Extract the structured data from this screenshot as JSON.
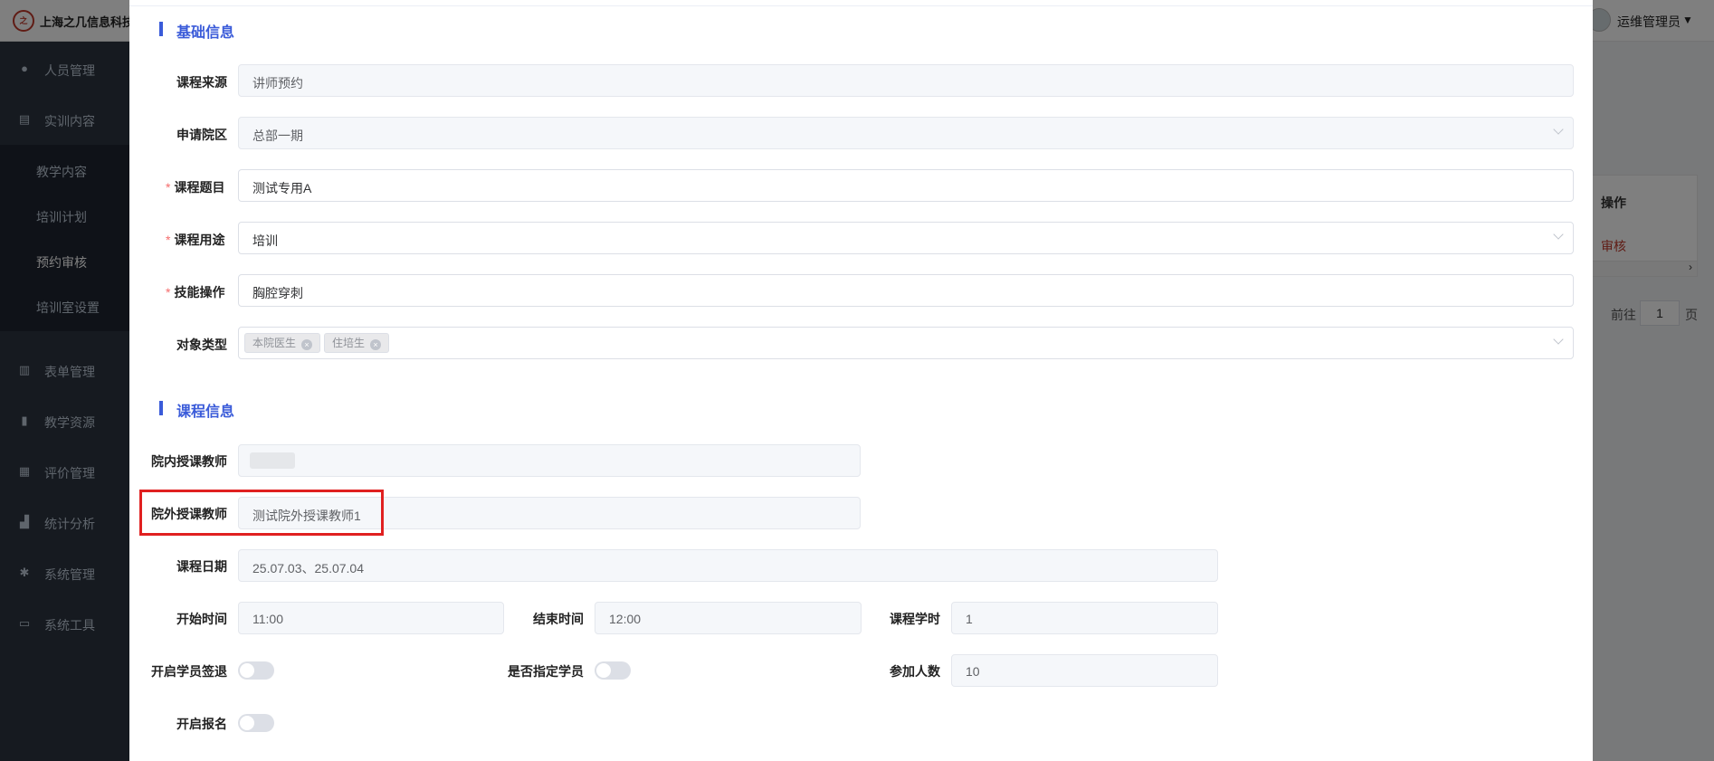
{
  "app": {
    "logo_text": "之",
    "title": "上海之几信息科技有限公司",
    "user_name": "运维管理员",
    "user_caret": "▼"
  },
  "sidebar": {
    "items": [
      {
        "label": "人员管理",
        "icon": "user-icon"
      },
      {
        "label": "实训内容",
        "icon": "book-icon"
      },
      {
        "label": "表单管理",
        "icon": "form-icon"
      },
      {
        "label": "教学资源",
        "icon": "resource-icon"
      },
      {
        "label": "评价管理",
        "icon": "evaluate-icon"
      },
      {
        "label": "统计分析",
        "icon": "chart-icon"
      },
      {
        "label": "系统管理",
        "icon": "gear-icon"
      },
      {
        "label": "系统工具",
        "icon": "toolbox-icon"
      }
    ],
    "sub_items": [
      {
        "label": "教学内容"
      },
      {
        "label": "培训计划"
      },
      {
        "label": "预约审核"
      },
      {
        "label": "培训室设置"
      }
    ]
  },
  "background_table": {
    "header_ops": "操作",
    "row_action": "审核",
    "goto_label": "前往",
    "page_value": "1",
    "page_unit": "页"
  },
  "dialog": {
    "basic_section_title": "基础信息",
    "course_section_title": "课程信息",
    "required_mark": "*",
    "fields": {
      "course_source": {
        "label": "课程来源",
        "value": "讲师预约"
      },
      "campus": {
        "label": "申请院区",
        "value": "总部一期"
      },
      "course_title": {
        "label": "课程题目",
        "value": "测试专用A"
      },
      "course_use": {
        "label": "课程用途",
        "value": "培训"
      },
      "skill_operation": {
        "label": "技能操作",
        "value": "胸腔穿刺"
      },
      "target_type": {
        "label": "对象类型",
        "tags": [
          "本院医生",
          "住培生"
        ]
      },
      "internal_teacher": {
        "label": "院内授课教师",
        "value": ""
      },
      "external_teacher": {
        "label": "院外授课教师",
        "value": "测试院外授课教师1"
      },
      "course_date": {
        "label": "课程日期",
        "value": "25.07.03、25.07.04"
      },
      "start_time": {
        "label": "开始时间",
        "value": "11:00"
      },
      "end_time": {
        "label": "结束时间",
        "value": "12:00"
      },
      "course_hours": {
        "label": "课程学时",
        "value": "1"
      },
      "enable_sign_in": {
        "label": "开启学员签退",
        "value": false
      },
      "designate_students": {
        "label": "是否指定学员",
        "value": false
      },
      "participants": {
        "label": "参加人数",
        "value": "10"
      },
      "enable_registration": {
        "label": "开启报名",
        "value": false
      }
    },
    "tag_close_glyph": "×"
  },
  "colors": {
    "accent": "#3a5bd9",
    "required": "#f56c6c",
    "highlight": "#e02020",
    "sidebar_bg": "#2d3541"
  }
}
